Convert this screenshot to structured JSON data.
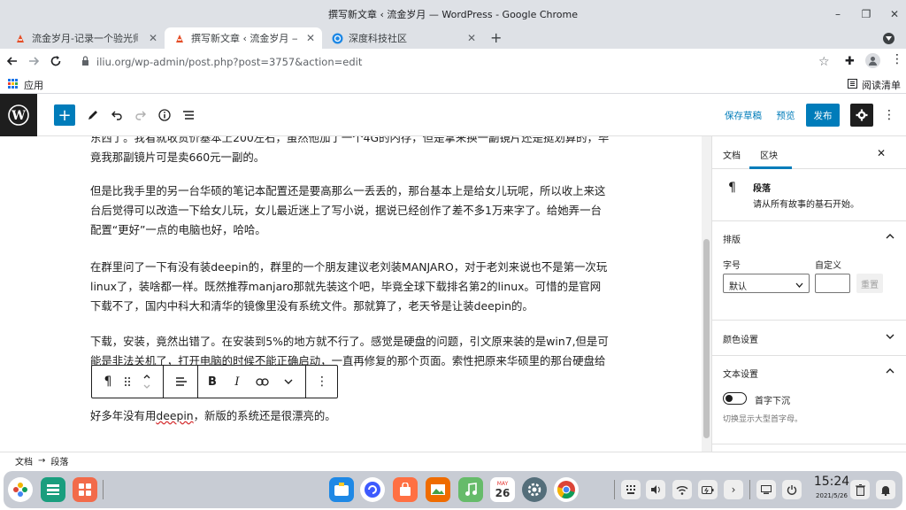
{
  "window": {
    "title": "撰写新文章 ‹ 流金岁月 — WordPress - Google Chrome",
    "min": "–",
    "max": "❐",
    "close": "✕"
  },
  "tabs": [
    {
      "label": "流金岁月-记录一个验光师著",
      "close": "✕"
    },
    {
      "label": "撰写新文章 ‹ 流金岁月 — Wo",
      "close": "✕"
    },
    {
      "label": "深度科技社区",
      "close": "✕"
    }
  ],
  "new_tab": "+",
  "address": {
    "url": "iliu.org/wp-admin/post.php?post=3757&action=edit"
  },
  "bookmarks": {
    "apps": "应用",
    "reading_list": "阅读清单"
  },
  "wp": {
    "save_draft": "保存草稿",
    "preview": "预览",
    "publish": "发布"
  },
  "content": {
    "p1": "东西了。我看就收货价基本上200左右，虽然他加了一个4G的内存，但是拿来换一副镜片还是挺划算的，毕竟我那副镜片可是卖660元一副的。",
    "p2": "但是比我手里的另一台华硕的笔记本配置还是要高那么一丢丢的，那台基本上是给女儿玩呢，所以收上来这台后觉得可以改造一下给女儿玩，女儿最近迷上了写小说，据说已经创作了差不多1万来字了。给她弄一台配置“更好”一点的电脑也好，哈哈。",
    "p3": "在群里问了一下有没有装deepin的，群里的一个朋友建议老刘装MANJARO，对于老刘来说也不是第一次玩linux了，装啥都一样。既然推荐manjaro那就先装这个吧，毕竟全球下载排名第2的linux。可惜的是官网下载不了，国内中科大和清华的镜像里没有系统文件。那就算了，老天爷是让装deepin的。",
    "p4": "下载，安装，竟然出错了。在安装到5%的地方就不行了。感觉是硬盘的问题，引文原来装的是win7,但是可能是非法关机了，打开电脑的时候不能正确启动，一直再修复的那个页面。索性把原来华硕里的那台硬盘给交换",
    "p5a": "好多年没有用",
    "p5b": "deepin",
    "p5c": "，新版的系统还是很漂亮的。"
  },
  "sidebar": {
    "tab_doc": "文档",
    "tab_block": "区块",
    "close": "✕",
    "block_name": "段落",
    "block_desc": "请从所有故事的基石开始。",
    "typography": "排版",
    "font_size_label": "字号",
    "custom_label": "自定义",
    "font_size_value": "默认",
    "reset": "重置",
    "color_settings": "颜色设置",
    "text_settings": "文本设置",
    "drop_cap": "首字下沉",
    "drop_cap_help": "切换显示大型首字母。"
  },
  "footer": {
    "doc": "文档",
    "arrow": "→",
    "para": "段落"
  },
  "clock": {
    "time": "15:24",
    "date": "2021/5/26"
  },
  "calendar_day": "26",
  "calendar_month": "MAY"
}
